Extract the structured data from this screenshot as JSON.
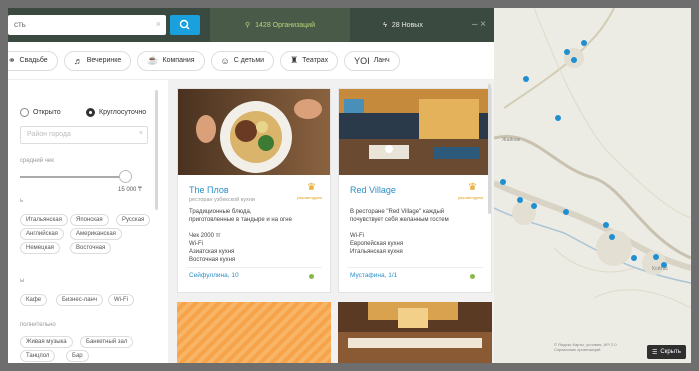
{
  "topbar": {
    "search_text": "сть",
    "search_clear": "×",
    "tab_orgs_label": "1428 Организаций",
    "tab_new_label": "28 Новых",
    "close": "–  ×"
  },
  "filters": [
    {
      "icon": "rings-icon",
      "glyph": "⚭",
      "label": "Свадьбе"
    },
    {
      "icon": "party-icon",
      "glyph": "♬",
      "label": "Вечеринке"
    },
    {
      "icon": "company-icon",
      "glyph": "☕",
      "label": "Компания"
    },
    {
      "icon": "kids-icon",
      "glyph": "☺",
      "label": "С детьми"
    },
    {
      "icon": "theater-icon",
      "glyph": "♜",
      "label": "Театрах"
    },
    {
      "icon": "lunch-icon",
      "glyph": "YOI",
      "label": "Ланч"
    }
  ],
  "sidebar": {
    "open_label": "Открыто",
    "allday_label": "Круглосуточно",
    "address_placeholder": "Район города",
    "check_label": "средний чек",
    "slider_value": "15 000 ₸",
    "slider_fraction": 0.95,
    "cuisine_tags": [
      "Итальянская",
      "Японская",
      "Русская",
      "Английская",
      "Американская",
      "Немецкая",
      "Восточная"
    ],
    "section_labels": [
      "ь",
      "ы"
    ],
    "type_tags": [
      "Кафе",
      "Бизнес-ланч",
      "Wi-Fi"
    ],
    "extras_label": "полнительно",
    "extra_tags": [
      "Живая музыка",
      "Банкетный зал",
      "Танцпол",
      "Бар"
    ]
  },
  "cards": [
    {
      "name": "The Плов",
      "subtitle": "ресторан узбекской кухни",
      "lines": [
        "Традиционные блюда,",
        "приготовленные в тандыре и на огне",
        "",
        "Чек 2000 тг",
        "Wi-Fi",
        "Азиатская кухня",
        "Восточная кухня"
      ],
      "address": "Сейфуллина, 10",
      "badge": "рекомендуем"
    },
    {
      "name": "Red Village",
      "subtitle": "",
      "lines": [
        "В ресторане \"Red Village\" каждый",
        "почувствует себя желанным гостем",
        "",
        "Wi-Fi",
        "Европейская кухня",
        "Итальянская кухня"
      ],
      "address": "Мустафина, 1/1",
      "badge": "рекомендуем"
    }
  ],
  "map": {
    "credit_1": "© Яндекс Карты, условия, API 2.0",
    "credit_2": "Справочник организаций",
    "hide_label": "Скрыть"
  }
}
